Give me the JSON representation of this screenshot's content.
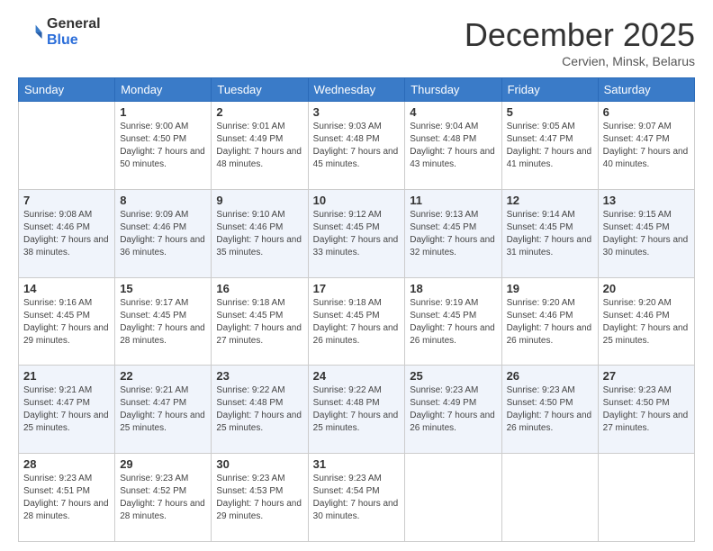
{
  "logo": {
    "general": "General",
    "blue": "Blue"
  },
  "header": {
    "month_year": "December 2025",
    "location": "Cervien, Minsk, Belarus"
  },
  "weekdays": [
    "Sunday",
    "Monday",
    "Tuesday",
    "Wednesday",
    "Thursday",
    "Friday",
    "Saturday"
  ],
  "weeks": [
    [
      {
        "day": "",
        "sunrise": "",
        "sunset": "",
        "daylight": ""
      },
      {
        "day": "1",
        "sunrise": "Sunrise: 9:00 AM",
        "sunset": "Sunset: 4:50 PM",
        "daylight": "Daylight: 7 hours and 50 minutes."
      },
      {
        "day": "2",
        "sunrise": "Sunrise: 9:01 AM",
        "sunset": "Sunset: 4:49 PM",
        "daylight": "Daylight: 7 hours and 48 minutes."
      },
      {
        "day": "3",
        "sunrise": "Sunrise: 9:03 AM",
        "sunset": "Sunset: 4:48 PM",
        "daylight": "Daylight: 7 hours and 45 minutes."
      },
      {
        "day": "4",
        "sunrise": "Sunrise: 9:04 AM",
        "sunset": "Sunset: 4:48 PM",
        "daylight": "Daylight: 7 hours and 43 minutes."
      },
      {
        "day": "5",
        "sunrise": "Sunrise: 9:05 AM",
        "sunset": "Sunset: 4:47 PM",
        "daylight": "Daylight: 7 hours and 41 minutes."
      },
      {
        "day": "6",
        "sunrise": "Sunrise: 9:07 AM",
        "sunset": "Sunset: 4:47 PM",
        "daylight": "Daylight: 7 hours and 40 minutes."
      }
    ],
    [
      {
        "day": "7",
        "sunrise": "Sunrise: 9:08 AM",
        "sunset": "Sunset: 4:46 PM",
        "daylight": "Daylight: 7 hours and 38 minutes."
      },
      {
        "day": "8",
        "sunrise": "Sunrise: 9:09 AM",
        "sunset": "Sunset: 4:46 PM",
        "daylight": "Daylight: 7 hours and 36 minutes."
      },
      {
        "day": "9",
        "sunrise": "Sunrise: 9:10 AM",
        "sunset": "Sunset: 4:46 PM",
        "daylight": "Daylight: 7 hours and 35 minutes."
      },
      {
        "day": "10",
        "sunrise": "Sunrise: 9:12 AM",
        "sunset": "Sunset: 4:45 PM",
        "daylight": "Daylight: 7 hours and 33 minutes."
      },
      {
        "day": "11",
        "sunrise": "Sunrise: 9:13 AM",
        "sunset": "Sunset: 4:45 PM",
        "daylight": "Daylight: 7 hours and 32 minutes."
      },
      {
        "day": "12",
        "sunrise": "Sunrise: 9:14 AM",
        "sunset": "Sunset: 4:45 PM",
        "daylight": "Daylight: 7 hours and 31 minutes."
      },
      {
        "day": "13",
        "sunrise": "Sunrise: 9:15 AM",
        "sunset": "Sunset: 4:45 PM",
        "daylight": "Daylight: 7 hours and 30 minutes."
      }
    ],
    [
      {
        "day": "14",
        "sunrise": "Sunrise: 9:16 AM",
        "sunset": "Sunset: 4:45 PM",
        "daylight": "Daylight: 7 hours and 29 minutes."
      },
      {
        "day": "15",
        "sunrise": "Sunrise: 9:17 AM",
        "sunset": "Sunset: 4:45 PM",
        "daylight": "Daylight: 7 hours and 28 minutes."
      },
      {
        "day": "16",
        "sunrise": "Sunrise: 9:18 AM",
        "sunset": "Sunset: 4:45 PM",
        "daylight": "Daylight: 7 hours and 27 minutes."
      },
      {
        "day": "17",
        "sunrise": "Sunrise: 9:18 AM",
        "sunset": "Sunset: 4:45 PM",
        "daylight": "Daylight: 7 hours and 26 minutes."
      },
      {
        "day": "18",
        "sunrise": "Sunrise: 9:19 AM",
        "sunset": "Sunset: 4:45 PM",
        "daylight": "Daylight: 7 hours and 26 minutes."
      },
      {
        "day": "19",
        "sunrise": "Sunrise: 9:20 AM",
        "sunset": "Sunset: 4:46 PM",
        "daylight": "Daylight: 7 hours and 26 minutes."
      },
      {
        "day": "20",
        "sunrise": "Sunrise: 9:20 AM",
        "sunset": "Sunset: 4:46 PM",
        "daylight": "Daylight: 7 hours and 25 minutes."
      }
    ],
    [
      {
        "day": "21",
        "sunrise": "Sunrise: 9:21 AM",
        "sunset": "Sunset: 4:47 PM",
        "daylight": "Daylight: 7 hours and 25 minutes."
      },
      {
        "day": "22",
        "sunrise": "Sunrise: 9:21 AM",
        "sunset": "Sunset: 4:47 PM",
        "daylight": "Daylight: 7 hours and 25 minutes."
      },
      {
        "day": "23",
        "sunrise": "Sunrise: 9:22 AM",
        "sunset": "Sunset: 4:48 PM",
        "daylight": "Daylight: 7 hours and 25 minutes."
      },
      {
        "day": "24",
        "sunrise": "Sunrise: 9:22 AM",
        "sunset": "Sunset: 4:48 PM",
        "daylight": "Daylight: 7 hours and 25 minutes."
      },
      {
        "day": "25",
        "sunrise": "Sunrise: 9:23 AM",
        "sunset": "Sunset: 4:49 PM",
        "daylight": "Daylight: 7 hours and 26 minutes."
      },
      {
        "day": "26",
        "sunrise": "Sunrise: 9:23 AM",
        "sunset": "Sunset: 4:50 PM",
        "daylight": "Daylight: 7 hours and 26 minutes."
      },
      {
        "day": "27",
        "sunrise": "Sunrise: 9:23 AM",
        "sunset": "Sunset: 4:50 PM",
        "daylight": "Daylight: 7 hours and 27 minutes."
      }
    ],
    [
      {
        "day": "28",
        "sunrise": "Sunrise: 9:23 AM",
        "sunset": "Sunset: 4:51 PM",
        "daylight": "Daylight: 7 hours and 28 minutes."
      },
      {
        "day": "29",
        "sunrise": "Sunrise: 9:23 AM",
        "sunset": "Sunset: 4:52 PM",
        "daylight": "Daylight: 7 hours and 28 minutes."
      },
      {
        "day": "30",
        "sunrise": "Sunrise: 9:23 AM",
        "sunset": "Sunset: 4:53 PM",
        "daylight": "Daylight: 7 hours and 29 minutes."
      },
      {
        "day": "31",
        "sunrise": "Sunrise: 9:23 AM",
        "sunset": "Sunset: 4:54 PM",
        "daylight": "Daylight: 7 hours and 30 minutes."
      },
      {
        "day": "",
        "sunrise": "",
        "sunset": "",
        "daylight": ""
      },
      {
        "day": "",
        "sunrise": "",
        "sunset": "",
        "daylight": ""
      },
      {
        "day": "",
        "sunrise": "",
        "sunset": "",
        "daylight": ""
      }
    ]
  ]
}
